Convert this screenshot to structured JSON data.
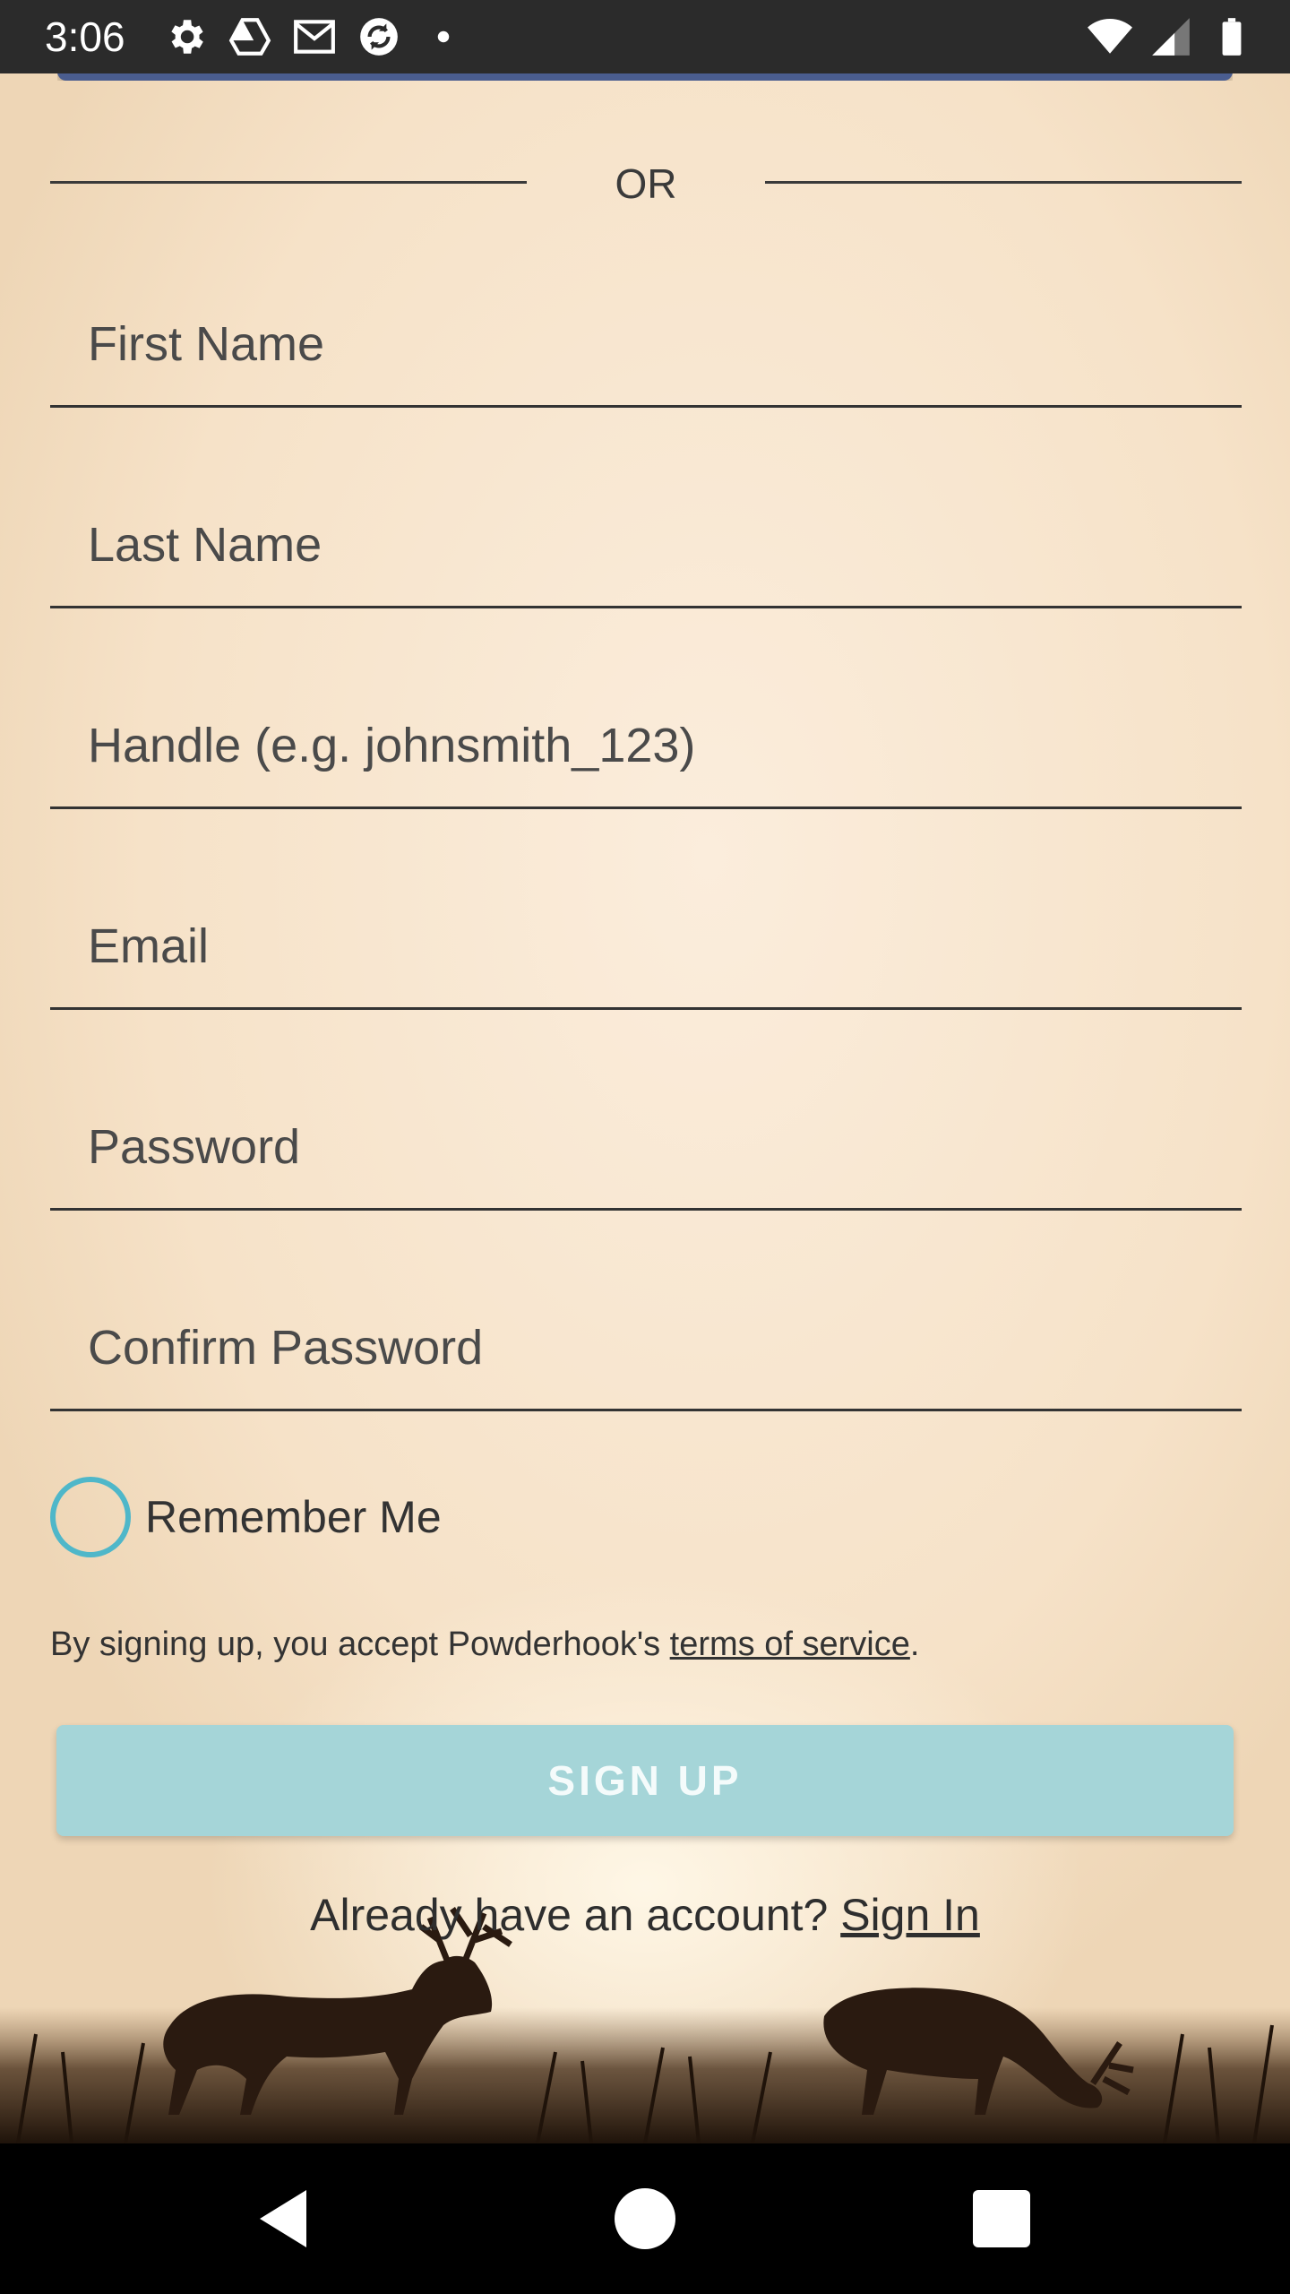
{
  "status_bar": {
    "time": "3:06",
    "left_icons": [
      "gear-icon",
      "drive-icon",
      "gmail-icon",
      "sync-icon",
      "dot-icon"
    ],
    "right_icons": [
      "wifi-icon",
      "signal-icon",
      "battery-icon"
    ]
  },
  "divider": {
    "label": "OR"
  },
  "form": {
    "first_name_placeholder": "First Name",
    "last_name_placeholder": "Last Name",
    "handle_placeholder": "Handle (e.g. johnsmith_123)",
    "email_placeholder": "Email",
    "password_placeholder": "Password",
    "confirm_password_placeholder": "Confirm Password",
    "remember_me_label": "Remember Me",
    "remember_me_checked": false
  },
  "terms": {
    "prefix": "By signing up, you accept Powderhook's ",
    "link_label": "terms of service",
    "suffix": "."
  },
  "signup_button": {
    "label": "SIGN UP"
  },
  "signin": {
    "prompt": "Already have an account? ",
    "link_label": "Sign In"
  },
  "colors": {
    "accent": "#4fb7c9",
    "signup_button_bg": "#a5d5d8",
    "status_bar_bg": "#2b2b2b",
    "nav_bar_bg": "#000000"
  },
  "nav_bar": {
    "buttons": [
      "back-icon",
      "home-icon",
      "recents-icon"
    ]
  }
}
